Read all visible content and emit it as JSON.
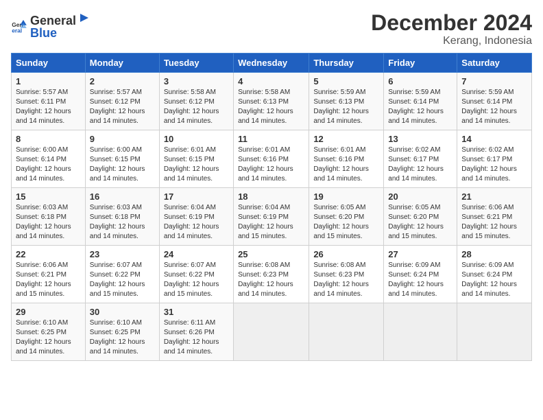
{
  "logo": {
    "general": "General",
    "blue": "Blue"
  },
  "title": "December 2024",
  "location": "Kerang, Indonesia",
  "days_header": [
    "Sunday",
    "Monday",
    "Tuesday",
    "Wednesday",
    "Thursday",
    "Friday",
    "Saturday"
  ],
  "weeks": [
    [
      {
        "day": "1",
        "sunrise": "5:57 AM",
        "sunset": "6:11 PM",
        "daylight": "12 hours and 14 minutes."
      },
      {
        "day": "2",
        "sunrise": "5:57 AM",
        "sunset": "6:12 PM",
        "daylight": "12 hours and 14 minutes."
      },
      {
        "day": "3",
        "sunrise": "5:58 AM",
        "sunset": "6:12 PM",
        "daylight": "12 hours and 14 minutes."
      },
      {
        "day": "4",
        "sunrise": "5:58 AM",
        "sunset": "6:13 PM",
        "daylight": "12 hours and 14 minutes."
      },
      {
        "day": "5",
        "sunrise": "5:59 AM",
        "sunset": "6:13 PM",
        "daylight": "12 hours and 14 minutes."
      },
      {
        "day": "6",
        "sunrise": "5:59 AM",
        "sunset": "6:14 PM",
        "daylight": "12 hours and 14 minutes."
      },
      {
        "day": "7",
        "sunrise": "5:59 AM",
        "sunset": "6:14 PM",
        "daylight": "12 hours and 14 minutes."
      }
    ],
    [
      {
        "day": "8",
        "sunrise": "6:00 AM",
        "sunset": "6:14 PM",
        "daylight": "12 hours and 14 minutes."
      },
      {
        "day": "9",
        "sunrise": "6:00 AM",
        "sunset": "6:15 PM",
        "daylight": "12 hours and 14 minutes."
      },
      {
        "day": "10",
        "sunrise": "6:01 AM",
        "sunset": "6:15 PM",
        "daylight": "12 hours and 14 minutes."
      },
      {
        "day": "11",
        "sunrise": "6:01 AM",
        "sunset": "6:16 PM",
        "daylight": "12 hours and 14 minutes."
      },
      {
        "day": "12",
        "sunrise": "6:01 AM",
        "sunset": "6:16 PM",
        "daylight": "12 hours and 14 minutes."
      },
      {
        "day": "13",
        "sunrise": "6:02 AM",
        "sunset": "6:17 PM",
        "daylight": "12 hours and 14 minutes."
      },
      {
        "day": "14",
        "sunrise": "6:02 AM",
        "sunset": "6:17 PM",
        "daylight": "12 hours and 14 minutes."
      }
    ],
    [
      {
        "day": "15",
        "sunrise": "6:03 AM",
        "sunset": "6:18 PM",
        "daylight": "12 hours and 14 minutes."
      },
      {
        "day": "16",
        "sunrise": "6:03 AM",
        "sunset": "6:18 PM",
        "daylight": "12 hours and 14 minutes."
      },
      {
        "day": "17",
        "sunrise": "6:04 AM",
        "sunset": "6:19 PM",
        "daylight": "12 hours and 14 minutes."
      },
      {
        "day": "18",
        "sunrise": "6:04 AM",
        "sunset": "6:19 PM",
        "daylight": "12 hours and 15 minutes."
      },
      {
        "day": "19",
        "sunrise": "6:05 AM",
        "sunset": "6:20 PM",
        "daylight": "12 hours and 15 minutes."
      },
      {
        "day": "20",
        "sunrise": "6:05 AM",
        "sunset": "6:20 PM",
        "daylight": "12 hours and 15 minutes."
      },
      {
        "day": "21",
        "sunrise": "6:06 AM",
        "sunset": "6:21 PM",
        "daylight": "12 hours and 15 minutes."
      }
    ],
    [
      {
        "day": "22",
        "sunrise": "6:06 AM",
        "sunset": "6:21 PM",
        "daylight": "12 hours and 15 minutes."
      },
      {
        "day": "23",
        "sunrise": "6:07 AM",
        "sunset": "6:22 PM",
        "daylight": "12 hours and 15 minutes."
      },
      {
        "day": "24",
        "sunrise": "6:07 AM",
        "sunset": "6:22 PM",
        "daylight": "12 hours and 15 minutes."
      },
      {
        "day": "25",
        "sunrise": "6:08 AM",
        "sunset": "6:23 PM",
        "daylight": "12 hours and 14 minutes."
      },
      {
        "day": "26",
        "sunrise": "6:08 AM",
        "sunset": "6:23 PM",
        "daylight": "12 hours and 14 minutes."
      },
      {
        "day": "27",
        "sunrise": "6:09 AM",
        "sunset": "6:24 PM",
        "daylight": "12 hours and 14 minutes."
      },
      {
        "day": "28",
        "sunrise": "6:09 AM",
        "sunset": "6:24 PM",
        "daylight": "12 hours and 14 minutes."
      }
    ],
    [
      {
        "day": "29",
        "sunrise": "6:10 AM",
        "sunset": "6:25 PM",
        "daylight": "12 hours and 14 minutes."
      },
      {
        "day": "30",
        "sunrise": "6:10 AM",
        "sunset": "6:25 PM",
        "daylight": "12 hours and 14 minutes."
      },
      {
        "day": "31",
        "sunrise": "6:11 AM",
        "sunset": "6:26 PM",
        "daylight": "12 hours and 14 minutes."
      },
      null,
      null,
      null,
      null
    ]
  ],
  "labels": {
    "sunrise": "Sunrise:",
    "sunset": "Sunset:",
    "daylight": "Daylight:"
  }
}
